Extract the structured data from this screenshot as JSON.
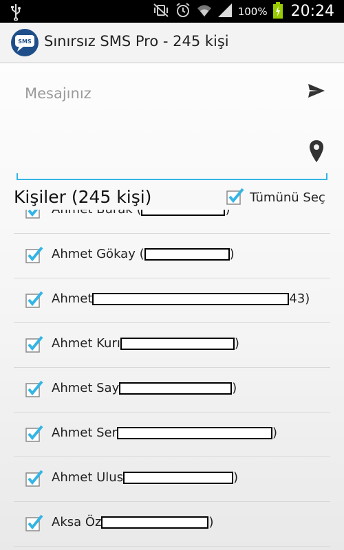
{
  "status_bar": {
    "battery": "100%",
    "time": "20:24"
  },
  "action_bar": {
    "app_icon_label": "SMS",
    "title": "Sınırsız SMS Pro - 245 kişi"
  },
  "message": {
    "placeholder": "Mesajınız"
  },
  "contacts": {
    "header": "Kişiler (245 kişi)",
    "select_all_label": "Tümünü Seç",
    "select_all_checked": true,
    "items": [
      {
        "prefix": "Ahmet Burak (",
        "suffix": ")",
        "checked": true
      },
      {
        "prefix": "Ahmet Gökay (",
        "suffix": ")",
        "checked": true
      },
      {
        "prefix": "Ahmet",
        "suffix": "43)",
        "checked": true
      },
      {
        "prefix": "Ahmet Kurı",
        "suffix": ")",
        "checked": true
      },
      {
        "prefix": "Ahmet Say",
        "suffix": ")",
        "checked": true
      },
      {
        "prefix": "Ahmet Ser",
        "suffix": ")",
        "checked": true
      },
      {
        "prefix": "Ahmet Ulus",
        "suffix": ")",
        "checked": true
      },
      {
        "prefix": "Aksa Öz",
        "suffix": ")",
        "checked": true
      }
    ]
  },
  "colors": {
    "accent": "#33b5e5",
    "checkmark": "#33b5e5",
    "battery": "#99cc00"
  },
  "icons": {
    "usb": "usb-icon",
    "mute": "vibrate-mute-icon",
    "alarm": "alarm-icon",
    "wifi": "wifi-icon",
    "signal": "signal-icon",
    "battery": "battery-charging-icon",
    "send": "send-icon",
    "location": "location-pin-icon",
    "checkbox": "checkbox-checked-icon"
  }
}
